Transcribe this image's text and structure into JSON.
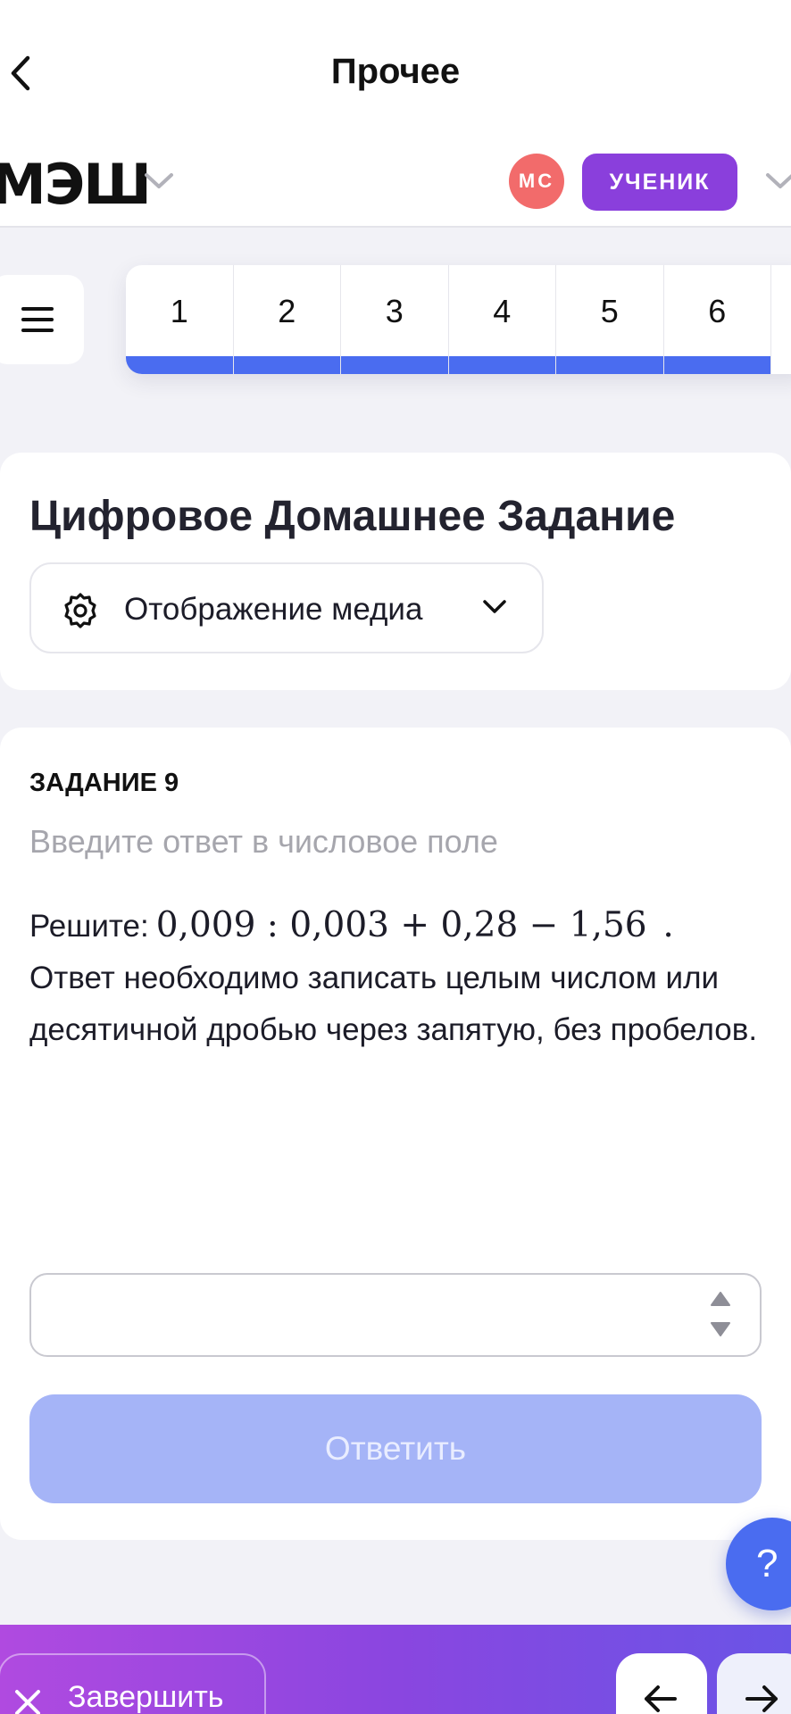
{
  "topnav": {
    "title": "Прочее"
  },
  "header": {
    "logo": "МЭШ",
    "avatar_initials": "МС",
    "role": "УЧЕНИК"
  },
  "tasks": {
    "tabs": [
      "1",
      "2",
      "3",
      "4",
      "5",
      "6"
    ],
    "progress_color": "#4a6cf0"
  },
  "title_card": {
    "title": "Цифровое Домашнее Задание",
    "media_select_label": "Отображение медиа"
  },
  "question": {
    "number_label": "ЗАДАНИЕ 9",
    "hint": "Введите ответ в числовое поле",
    "prefix": "Решите:",
    "expression": "0,009 : 0,003 + 0,28 − 1,56",
    "expression_suffix": ".",
    "instructions": "Ответ необходимо записать целым числом или десятичной дробью через запятую, без пробелов.",
    "answer_value": "",
    "submit_label": "Ответить"
  },
  "help": {
    "label": "?"
  },
  "bottom": {
    "finish_label": "Завершить"
  },
  "colors": {
    "accent": "#4a6cf0",
    "role_badge": "#8a3fdc",
    "avatar": "#f26b6b",
    "submit_disabled": "#a5b4f7"
  }
}
